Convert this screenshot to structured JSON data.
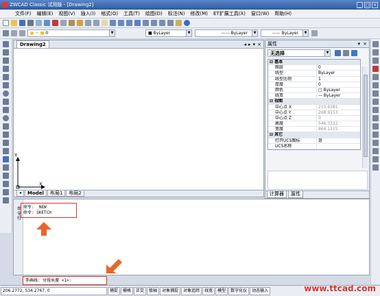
{
  "window": {
    "title": "ZWCAD Classic 试用版 - [Drawing2]"
  },
  "menu": [
    "文件(F)",
    "编辑(E)",
    "视图(V)",
    "插入(I)",
    "格式(O)",
    "工具(T)",
    "绘图(D)",
    "标注(N)",
    "修改(M)",
    "ET扩展工具(X)",
    "窗口(W)",
    "帮助(H)"
  ],
  "toolbar": {
    "layer_value": "0",
    "color_value": "ByLayer",
    "linetype_value": "ByLayer",
    "lineweight_value": "ByLayer"
  },
  "document": {
    "tab": "Drawing2",
    "ucs_x": "X",
    "ucs_y": "Y"
  },
  "layout_tabs": [
    "Model",
    "布局1",
    "布局2"
  ],
  "properties": {
    "title": "属性",
    "selection": "无选择",
    "groups": [
      {
        "name": "基本",
        "rows": [
          {
            "k": "图层",
            "v": "0"
          },
          {
            "k": "线型",
            "v": "ByLayer"
          },
          {
            "k": "线型比例",
            "v": "1"
          },
          {
            "k": "厚度",
            "v": "0"
          },
          {
            "k": "颜色",
            "v": "□ ByLayer"
          },
          {
            "k": "线宽",
            "v": "— ByLayer"
          }
        ]
      },
      {
        "name": "视图",
        "rows": [
          {
            "k": "中心点 X",
            "v": "213.6381"
          },
          {
            "k": "中心点 Y",
            "v": "268.9153"
          },
          {
            "k": "中心点 Z",
            "v": "0"
          },
          {
            "k": "高度",
            "v": "546.3322"
          },
          {
            "k": "宽度",
            "v": "864.1215"
          }
        ]
      },
      {
        "name": "其它",
        "rows": [
          {
            "k": "打开UCS图标",
            "v": "是"
          },
          {
            "k": "UCS名称",
            "v": ""
          }
        ]
      }
    ],
    "bottom_tabs": [
      "计算器",
      "属性"
    ]
  },
  "command": {
    "history": [
      "命令: _NEW",
      "命令: SKETCH"
    ],
    "prompt": "手画线: 分段长度 <1>:",
    "side_label": "命令行"
  },
  "status": {
    "coords": "206.2772,  534.2767,  0",
    "buttons": [
      "捕捉",
      "栅格",
      "正交",
      "极轴",
      "对象捕捉",
      "对象追踪",
      "线宽",
      "模型",
      "数字化仪",
      "动态输入"
    ]
  },
  "watermark": "www.ttcad.com",
  "colors": {
    "accent": "#2e5aa0",
    "highlight": "#d9302a",
    "arrow": "#e8652a"
  }
}
